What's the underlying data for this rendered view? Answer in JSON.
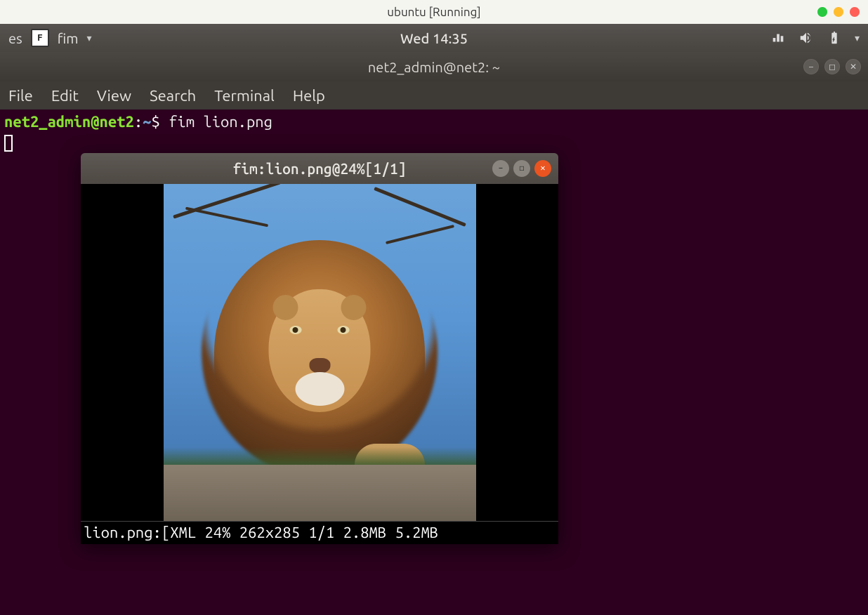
{
  "vm": {
    "title": "ubuntu [Running]"
  },
  "panel": {
    "left_text": "es",
    "app_name": "fim",
    "clock": "Wed 14:35"
  },
  "terminal_window": {
    "title": "net2_admin@net2: ~",
    "menu": {
      "file": "File",
      "edit": "Edit",
      "view": "View",
      "search": "Search",
      "terminal": "Terminal",
      "help": "Help"
    },
    "prompt": {
      "user_host": "net2_admin@net2",
      "path": "~",
      "command": "fim lion.png"
    }
  },
  "fim_window": {
    "title": "fim:lion.png@24%[1/1]",
    "status": "lion.png:[XML 24% 262x285 1/1 2.8MB 5.2MB",
    "image_desc": "lion photo"
  }
}
